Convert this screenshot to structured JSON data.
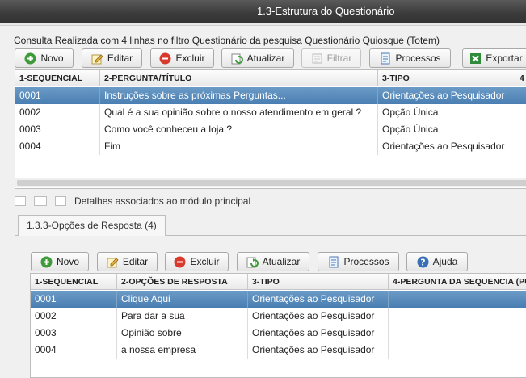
{
  "window": {
    "title": "1.3-Estrutura do Questionário"
  },
  "query_status": "Consulta Realizada com 4 linhas no filtro Questionário da pesquisa Questionário Quiosque (Totem)",
  "toolbar": {
    "novo": "Novo",
    "editar": "Editar",
    "excluir": "Excluir",
    "atualizar": "Atualizar",
    "filtrar": "Filtrar",
    "processos": "Processos",
    "exportar": "Exportar"
  },
  "main_grid": {
    "headers": [
      "1-SEQUENCIAL",
      "2-PERGUNTA/TÍTULO",
      "3-TIPO",
      "4"
    ],
    "rows": [
      [
        "0001",
        "Instruções sobre as próximas Perguntas...",
        "Orientações ao Pesquisador"
      ],
      [
        "0002",
        "Qual é a sua opinião sobre o nosso atendimento em geral ?",
        "Opção Única"
      ],
      [
        "0003",
        "Como você conheceu a loja ?",
        "Opção Única"
      ],
      [
        "0004",
        "Fim",
        "Orientações ao Pesquisador"
      ]
    ],
    "selected_row": 0
  },
  "details": {
    "label": "Detalhes associados ao módulo principal"
  },
  "detail_tab": {
    "label": "1.3.3-Opções de Resposta (4)"
  },
  "detail_toolbar": {
    "novo": "Novo",
    "editar": "Editar",
    "excluir": "Excluir",
    "atualizar": "Atualizar",
    "processos": "Processos",
    "ajuda": "Ajuda"
  },
  "detail_grid": {
    "headers": [
      "1-SEQUENCIAL",
      "2-OPÇÕES DE RESPOSTA",
      "3-TIPO",
      "4-PERGUNTA DA SEQUENCIA (PU"
    ],
    "rows": [
      [
        "0001",
        "Clique Aqui",
        "Orientações ao Pesquisador",
        ""
      ],
      [
        "0002",
        "Para dar a sua",
        "Orientações ao Pesquisador",
        ""
      ],
      [
        "0003",
        "Opinião sobre",
        "Orientações ao Pesquisador",
        ""
      ],
      [
        "0004",
        "a nossa empresa",
        "Orientações ao Pesquisador",
        ""
      ]
    ],
    "selected_row": 0
  },
  "colors": {
    "selection": "#4a7eb2",
    "titlebar": "#3b3b3b"
  }
}
